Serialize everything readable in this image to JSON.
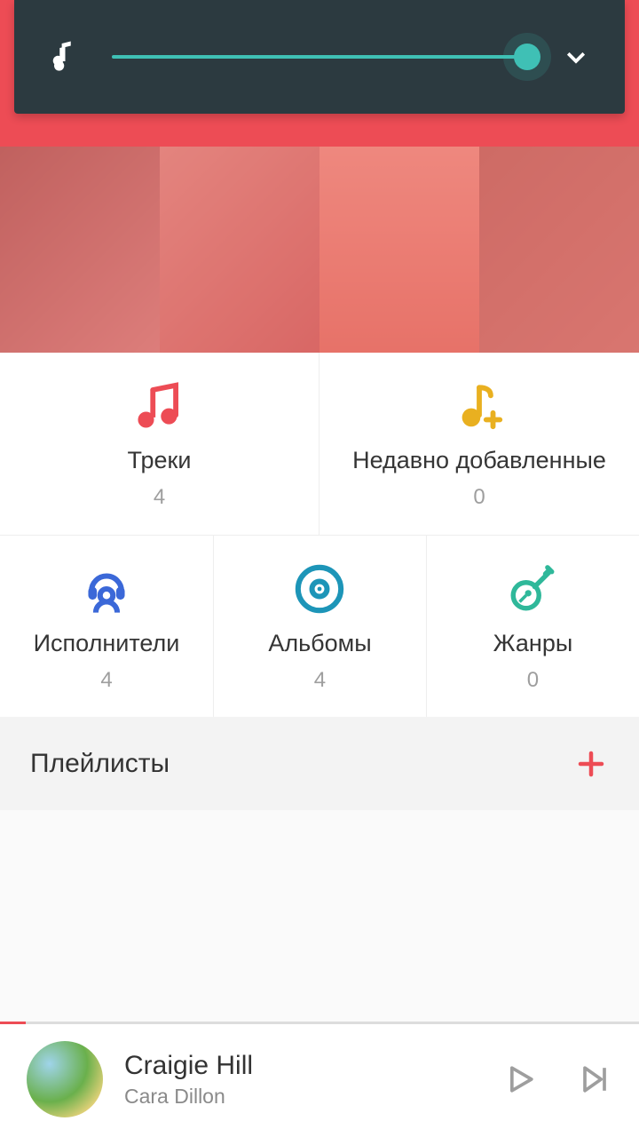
{
  "volume_percent": 100,
  "categories": {
    "tracks": {
      "label": "Треки",
      "count": "4"
    },
    "recent": {
      "label": "Недавно добавленные",
      "count": "0"
    },
    "artists": {
      "label": "Исполнители",
      "count": "4"
    },
    "albums": {
      "label": "Альбомы",
      "count": "4"
    },
    "genres": {
      "label": "Жанры",
      "count": "0"
    }
  },
  "playlists": {
    "title": "Плейлисты"
  },
  "now_playing": {
    "title": "Craigie Hill",
    "artist": "Cara Dillon",
    "progress_percent": 4
  }
}
